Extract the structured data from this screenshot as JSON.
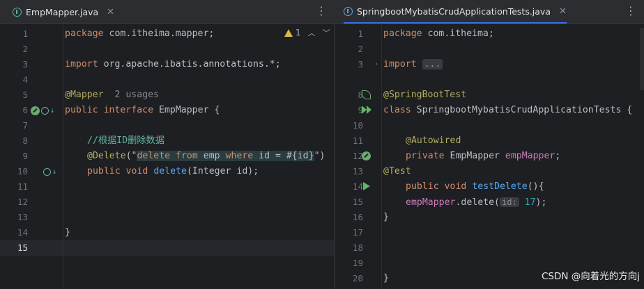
{
  "left_editor": {
    "tab": {
      "label": "EmpMapper.java",
      "close": "✕"
    },
    "inspections": {
      "warning_count": "1"
    },
    "line_numbers": [
      "1",
      "2",
      "3",
      "4",
      "5",
      "6",
      "7",
      "8",
      "9",
      "10",
      "11",
      "12",
      "13",
      "14",
      "15"
    ],
    "code": {
      "l1_kw": "package",
      "l1_rest": " com.itheima.mapper;",
      "l3_kw": "import",
      "l3_rest": " org.apache.ibatis.annotations.*;",
      "l5_ann": "@Mapper",
      "l5_usage": "2 usages",
      "l6_kw1": "public",
      "l6_kw2": "interface",
      "l6_rest": " EmpMapper {",
      "l8_comment": "//根据ID删除数据",
      "l9_ann": "@Delete",
      "l9_p1": "(\"",
      "l9_sql1": "delete",
      "l9_sql2": " from ",
      "l9_sql3": "emp ",
      "l9_sql4": "where",
      "l9_sql5": " id = #{id}",
      "l9_p2": "\")",
      "l10_kw1": "public",
      "l10_kw2": "void",
      "l10_method": "delete",
      "l10_rest": "(Integer id);",
      "l14_rest": "}"
    }
  },
  "right_editor": {
    "tab": {
      "label": "SpringbootMybatisCrudApplicationTests.java",
      "close": "✕"
    },
    "line_numbers": [
      "1",
      "2",
      "3",
      "8",
      "9",
      "10",
      "11",
      "12",
      "13",
      "14",
      "15",
      "16",
      "17",
      "18",
      "19",
      "20"
    ],
    "code": {
      "l1_kw": "package",
      "l1_rest": " com.itheima;",
      "l3_kw": "import",
      "l3_fold": "...",
      "l8_ann": "@SpringBootTest",
      "l9_kw": "class",
      "l9_rest": " SpringbootMybatisCrudApplicationTests {",
      "l11_ann": "@Autowired",
      "l12_kw": "private",
      "l12_type": " EmpMapper ",
      "l12_field": "empMapper",
      "l12_end": ";",
      "l13_ann": "@Test",
      "l14_kw1": "public",
      "l14_kw2": "void",
      "l14_method": "testDelete",
      "l14_rest": "(){",
      "l15_field": "empMapper",
      "l15_call": ".delete(",
      "l15_hint": "id:",
      "l15_num": "17",
      "l15_end": ");",
      "l16_rest": "}",
      "l20_rest": "}"
    }
  },
  "watermark": "CSDN @向着光的方向j",
  "colors": {
    "background": "#1e1f22",
    "tab_accent": "#3574f0",
    "keyword": "#cf8e6d",
    "annotation": "#b3ae60",
    "method": "#56a8f5",
    "string": "#6aab73",
    "comment": "#5fb6a0",
    "number": "#2aacb8",
    "field": "#c77dbb"
  }
}
